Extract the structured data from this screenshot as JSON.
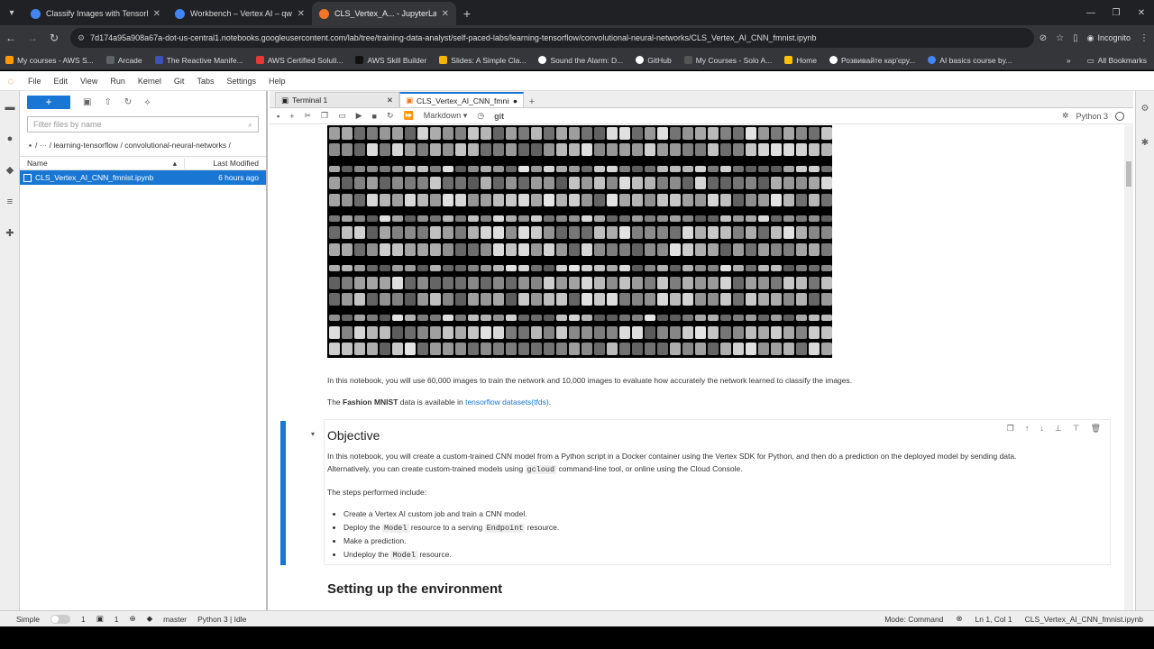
{
  "browser": {
    "tabs": [
      {
        "title": "Classify Images with TensorFlo",
        "color": "#4285f4"
      },
      {
        "title": "Workbench – Vertex AI – qwikla",
        "color": "#4285f4"
      },
      {
        "title": "CLS_Vertex_A... - JupyterLab",
        "color": "#f37726"
      }
    ],
    "url": "7d174a95a908a67a-dot-us-central1.notebooks.googleusercontent.com/lab/tree/training-data-analyst/self-paced-labs/learning-tensorflow/convolutional-neural-networks/CLS_Vertex_AI_CNN_fmnist.ipynb",
    "incognito_label": "Incognito",
    "bookmarks": [
      {
        "label": "My courses - AWS S...",
        "color": "#ff9900"
      },
      {
        "label": "Arcade",
        "color": "#5f6368"
      },
      {
        "label": "The Reactive Manife...",
        "color": "#3f51b5"
      },
      {
        "label": "AWS Certified Soluti...",
        "color": "#e53935"
      },
      {
        "label": "AWS Skill Builder",
        "color": "#232f3e"
      },
      {
        "label": "Slides: A Simple Cla...",
        "color": "#f4b400"
      },
      {
        "label": "Sound the Alarm: D...",
        "color": "#ffffff"
      },
      {
        "label": "GitHub",
        "color": "#ffffff"
      },
      {
        "label": "My Courses - Solo A...",
        "color": "#555555"
      },
      {
        "label": "Home",
        "color": "#ffc107"
      },
      {
        "label": "Розвивайте кар'єру...",
        "color": "#ffffff"
      },
      {
        "label": "AI basics course by...",
        "color": "#4285f4"
      }
    ],
    "all_bookmarks": "All Bookmarks"
  },
  "menu": [
    "File",
    "Edit",
    "View",
    "Run",
    "Kernel",
    "Git",
    "Tabs",
    "Settings",
    "Help"
  ],
  "filebrowser": {
    "search_placeholder": "Filter files by name",
    "breadcrumb": "/   ···   / learning-tensorflow / convolutional-neural-networks /",
    "col_name": "Name",
    "col_modified": "Last Modified",
    "files": [
      {
        "name": "CLS_Vertex_AI_CNN_fmnist.ipynb",
        "modified": "6 hours ago"
      }
    ]
  },
  "doc_tabs": [
    {
      "label": "Terminal 1",
      "active": false
    },
    {
      "label": "CLS_Vertex_AI_CNN_fmnist.ip",
      "active": true
    }
  ],
  "nb_toolbar": {
    "cell_type": "Markdown",
    "git": "git",
    "kernel": "Python 3"
  },
  "notebook": {
    "para1": "In this notebook, you will use 60,000 images to train the network and 10,000 images to evaluate how accurately the network learned to classify the images.",
    "para2_pre": "The ",
    "para2_bold": "Fashion MNIST",
    "para2_mid": " data is available in ",
    "para2_link": "tensorflow datasets(tfds)",
    "para2_post": ".",
    "objective_title": "Objective",
    "obj_p1": "In this notebook, you will create a custom-trained CNN model from a Python script in a Docker container using the Vertex SDK for Python, and then do a prediction on the deployed model by sending data.",
    "obj_p2_pre": "Alternatively, you can create custom-trained models using ",
    "obj_p2_code": "gcloud",
    "obj_p2_post": " command-line tool, or online using the Cloud Console.",
    "steps_intro": "The steps performed include:",
    "step1": "Create a Vertex AI custom job and train a CNN model.",
    "step2_a": "Deploy the ",
    "step2_code1": "Model",
    "step2_b": " resource to a serving ",
    "step2_code2": "Endpoint",
    "step2_c": " resource.",
    "step3": "Make a prediction.",
    "step4_a": "Undeploy the ",
    "step4_code": "Model",
    "step4_b": " resource.",
    "setup_title": "Setting up the environment"
  },
  "status": {
    "mode_label": "Simple",
    "count1": "1",
    "count2": "1",
    "branch": "master",
    "kernel": "Python 3 | Idle",
    "mode": "Mode: Command",
    "position": "Ln 1, Col 1",
    "filename": "CLS_Vertex_AI_CNN_fmnist.ipynb"
  }
}
